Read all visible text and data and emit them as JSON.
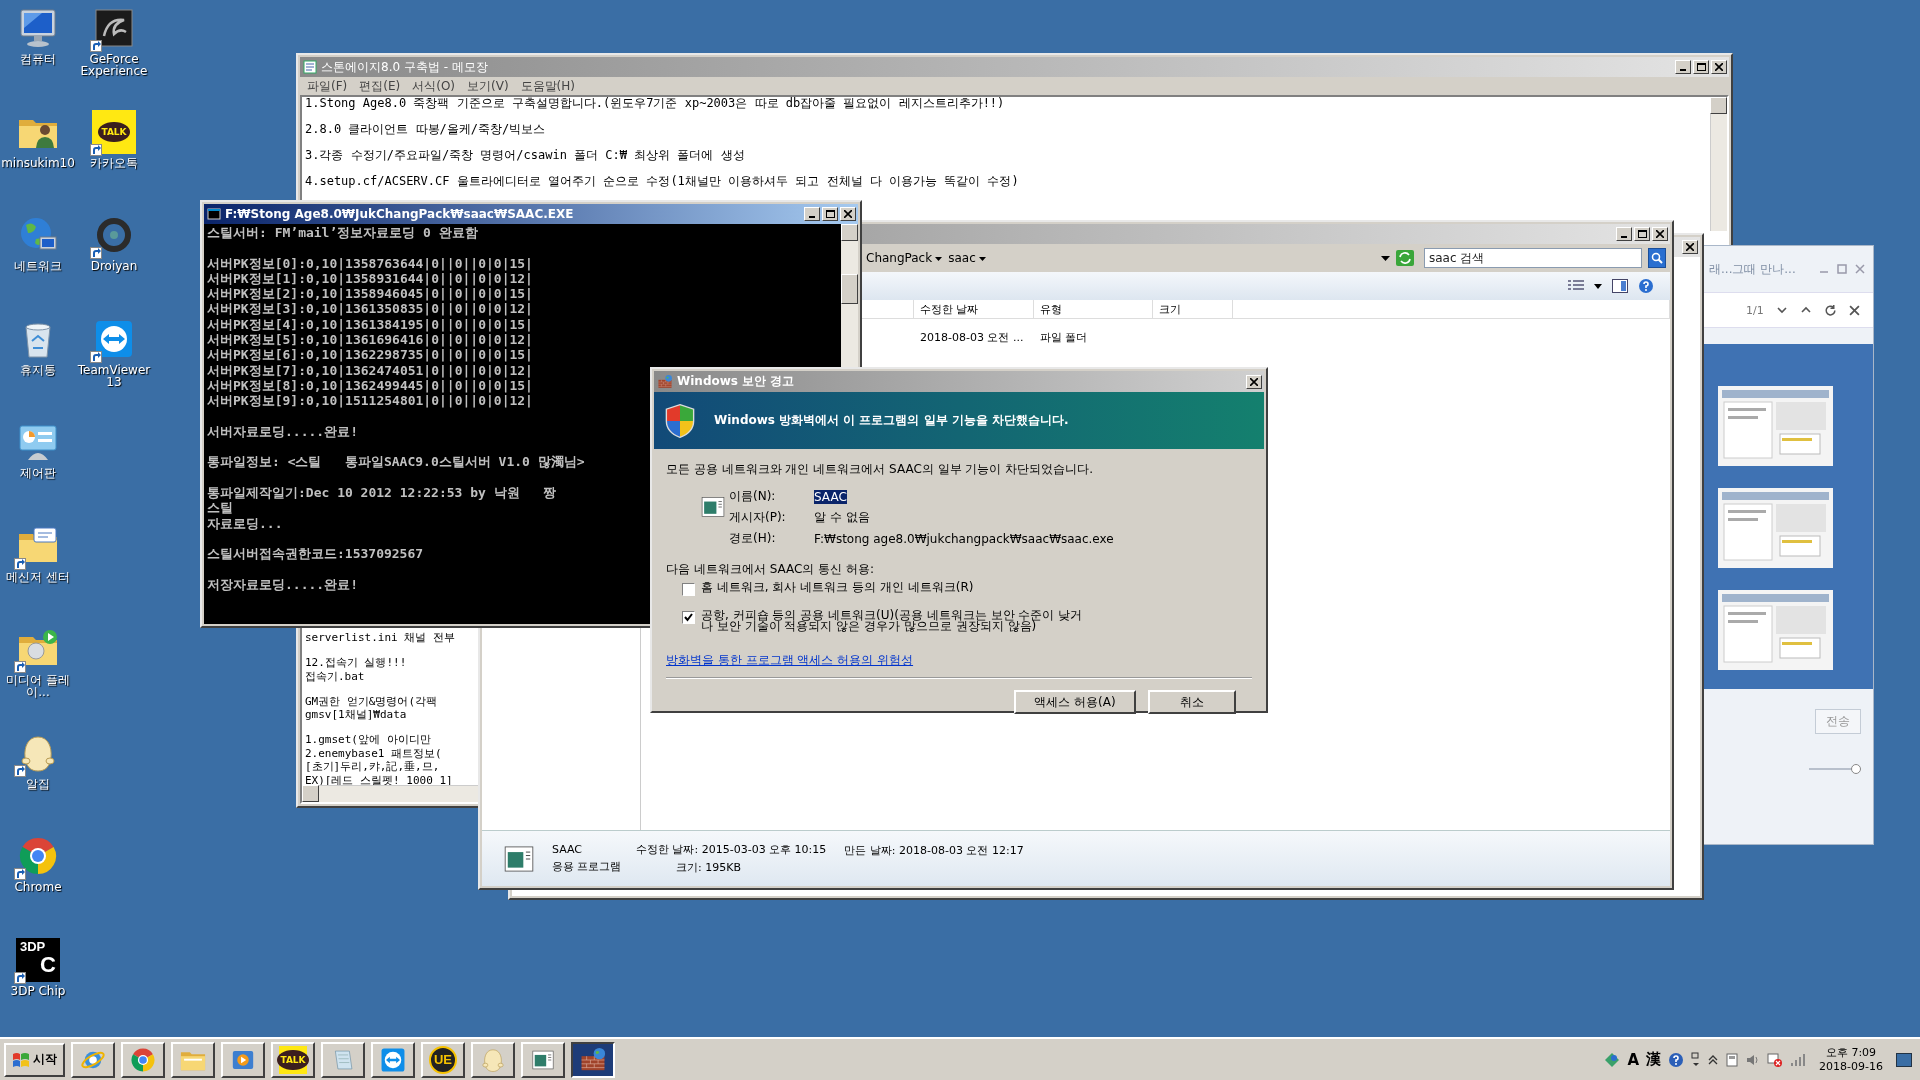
{
  "desktop_icons": [
    {
      "label": "컴퓨터",
      "kind": "computer",
      "shortcut": false
    },
    {
      "label": "minsukim10",
      "kind": "user-folder",
      "shortcut": false
    },
    {
      "label": "네트워크",
      "kind": "network",
      "shortcut": false
    },
    {
      "label": "휴지통",
      "kind": "recycle",
      "shortcut": false
    },
    {
      "label": "제어판",
      "kind": "control-panel",
      "shortcut": false
    },
    {
      "label": "메신저 센터",
      "kind": "messenger",
      "shortcut": true
    },
    {
      "label": "미디어 플레이...",
      "kind": "media",
      "shortcut": true
    },
    {
      "label": "알집",
      "kind": "alzip",
      "shortcut": true
    },
    {
      "label": "Chrome",
      "kind": "chrome",
      "shortcut": true
    },
    {
      "label": "3DP Chip",
      "kind": "chip",
      "shortcut": true,
      "badge": "3DP",
      "badge_2": "C"
    },
    {
      "label": "GeForce Experience",
      "kind": "geforce",
      "shortcut": true
    },
    {
      "label": "카카오톡",
      "kind": "kakao",
      "shortcut": true,
      "badge": "TALK"
    },
    {
      "label": "Droiyan",
      "kind": "droiyan",
      "shortcut": true
    },
    {
      "label": "TeamViewer 13",
      "kind": "teamviewer",
      "shortcut": true
    }
  ],
  "notepad": {
    "title": "스톤에이지8.0 구축법 - 메모장",
    "menu": [
      "파일(F)",
      "편집(E)",
      "서식(O)",
      "보기(V)",
      "도움말(H)"
    ],
    "lines": [
      "1.Stong Age8.0 죽창팩 기준으로 구축설명합니다.(윈도우7기준 xp~2003은 따로 db잡아줄 필요없이 레지스트리추가!!)",
      "2.8.0 클라이언트 따봉/올케/죽창/빅보스",
      "3.각종 수정기/주요파일/죽창 명령어/csawin 폴더 C:₩ 최상위 폴더에 생성",
      "4.setup.cf/ACSERV.CF 울트라에디터로 열어주기 순으로 수정(1채널만 이용하셔두 되고 전체널 다 이용가능 똑같이 수정)"
    ],
    "lower_groups": [
      [
        "serverlist.ini 채널 전부"
      ],
      [
        "12.접속기 실행!!!",
        "접속기.bat"
      ],
      [
        "GM권한 얻기&명령어(각팩",
        "gmsv[1채널]₩data"
      ],
      [
        "1.gmset(앞에 아이디만",
        "2.enemybase1 패트정보(",
        "[초기]두리,캬,記,垂,므,",
        "EX)[레드 스릴펫! 1000 1]"
      ]
    ]
  },
  "console": {
    "title": "F:₩Stong Age8.0₩JukChangPack₩saac₩SAAC.EXE",
    "blocks": [
      [
        "스틸서버: FM’mail’정보자료로딩 0 완료함"
      ],
      [
        "서버PK정보[0]:0,10|1358763644|0||0||0|0|15|",
        "서버PK정보[1]:0,10|1358931644|0||0||0|0|12|",
        "서버PK정보[2]:0,10|1358946045|0||0||0|0|15|",
        "서버PK정보[3]:0,10|1361350835|0||0||0|0|12|",
        "서버PK정보[4]:0,10|1361384195|0||0||0|0|15|",
        "서버PK정보[5]:0,10|1361696416|0||0||0|0|12|",
        "서버PK정보[6]:0,10|1362298735|0||0||0|0|15|",
        "서버PK정보[7]:0,10|1362474051|0||0||0|0|12|",
        "서버PK정보[8]:0,10|1362499445|0||0||0|0|15|",
        "서버PK정보[9]:0,10|1511254801|0||0||0|0|12|"
      ],
      [
        "서버자료로딩.....완료!"
      ],
      [
        "통파일정보: <스틸   통파일SAAC9.0스틸서버 V1.0 많濁님>"
      ],
      [
        "통파일제작일기:Dec 10 2012 12:22:53 by 낙원   짱",
        "스틸",
        "자료로딩..."
      ],
      [
        "스틸서버접속권한코드:1537092567"
      ],
      [
        "저장자료로딩.....완료!"
      ]
    ]
  },
  "explorer": {
    "breadcrumb": [
      "ChangPack",
      "saac"
    ],
    "search": {
      "placeholder": "saac 검색"
    },
    "columns": [
      "수정한 날짜",
      "유형",
      "크기"
    ],
    "rows": [
      {
        "modified": "2018-08-03 오전 ...",
        "type": "파일 폴더"
      }
    ],
    "details": {
      "name": "SAAC",
      "type": "응용 프로그램",
      "modified": "수정한 날짜: 2015-03-03 오후 10:15",
      "size": "크기: 195KB",
      "created": "만든 날짜: 2018-08-03 오전 12:17"
    }
  },
  "dialog": {
    "title": "Windows 보안 경고",
    "headline": "Windows 방화벽에서 이 프로그램의 일부 기능을 차단했습니다.",
    "message": "모든 공용 네트워크와 개인 네트워크에서 SAAC의 일부 기능이 차단되었습니다.",
    "fields": [
      {
        "label": "이름(N):",
        "value": "SAAC",
        "selected": true
      },
      {
        "label": "게시자(P):",
        "value": "알 수 없음",
        "selected": false
      },
      {
        "label": "경로(H):",
        "value": "F:₩stong age8.0₩jukchangpack₩saac₩saac.exe",
        "selected": false
      }
    ],
    "allow_label": "다음 네트워크에서 SAAC의 통신 허용:",
    "options": [
      {
        "label": "홈 네트워크, 회사 네트워크 등의 개인 네트워크(R)",
        "checked": false
      },
      {
        "label": "공항, 커피숍 등의 공용 네트워크(U)(공용 네트워크는 보안 수준이 낮거나 보안 기술이 적용되지 않은 경우가 많으므로 권장되지 않음)",
        "checked": true
      }
    ],
    "link": "방화벽을 통한 프로그램 액세스 허용의 위험성",
    "buttons": [
      "액세스 허용(A)",
      "취소"
    ]
  },
  "panel": {
    "title": "래...그때 만나...",
    "page": "1/1",
    "send": "전송",
    "zoom": {
      "level": 1
    }
  },
  "taskbar": {
    "start": "시작",
    "buttons": [
      {
        "kind": "ie",
        "selected": false
      },
      {
        "kind": "chrome",
        "selected": false
      },
      {
        "kind": "folder",
        "selected": false
      },
      {
        "kind": "media",
        "selected": false
      },
      {
        "kind": "kakao",
        "badge": "TALK",
        "selected": false
      },
      {
        "kind": "notebook",
        "selected": false
      },
      {
        "kind": "teamviewer",
        "selected": false
      },
      {
        "kind": "ue",
        "badge": "UE",
        "selected": false
      },
      {
        "kind": "alzip",
        "selected": false
      },
      {
        "kind": "app-window",
        "selected": false
      },
      {
        "kind": "firewall",
        "selected": true
      }
    ],
    "ime": [
      "A",
      "漢"
    ],
    "time": "오후 7:09",
    "date": "2018-09-16"
  }
}
